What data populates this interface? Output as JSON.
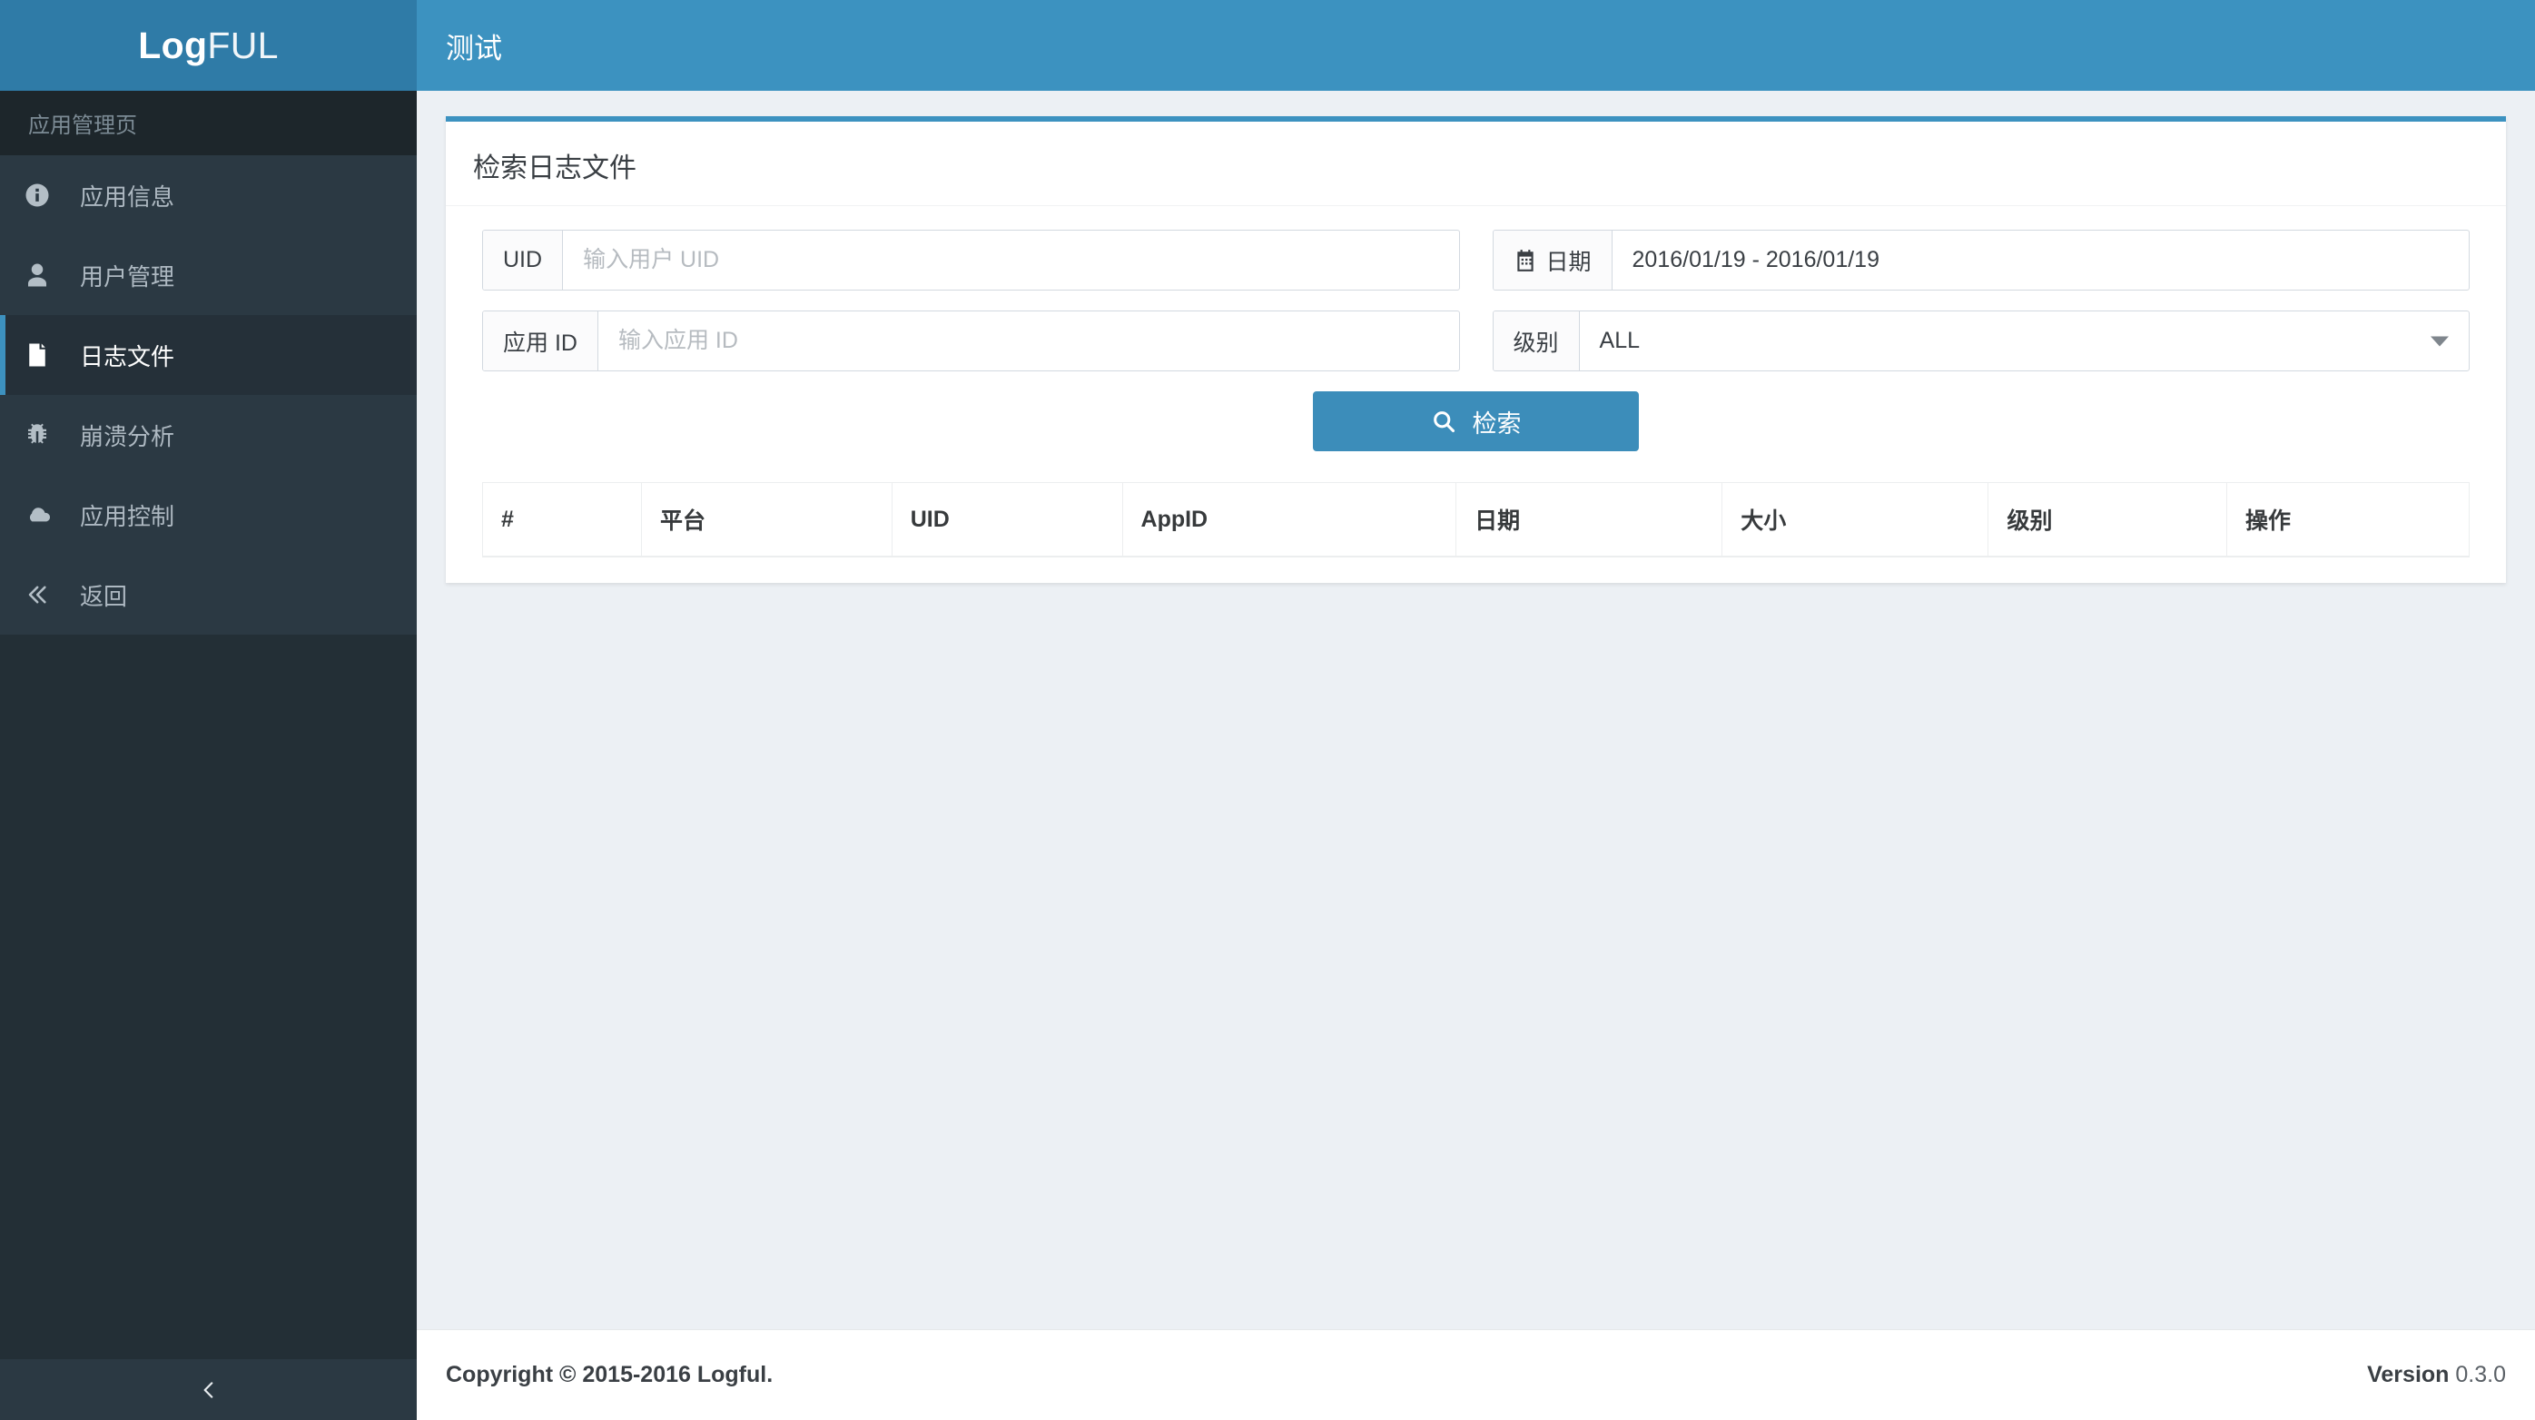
{
  "brand": {
    "bold": "Log",
    "light": "FUL"
  },
  "sidebar": {
    "header": "应用管理页",
    "items": [
      {
        "label": "应用信息",
        "icon": "info-circle-icon",
        "active": false
      },
      {
        "label": "用户管理",
        "icon": "user-icon",
        "active": false
      },
      {
        "label": "日志文件",
        "icon": "file-icon",
        "active": true
      },
      {
        "label": "崩溃分析",
        "icon": "bug-icon",
        "active": false
      },
      {
        "label": "应用控制",
        "icon": "cloud-icon",
        "active": false
      },
      {
        "label": "返回",
        "icon": "double-chevron-left-icon",
        "active": false
      }
    ],
    "collapse_icon": "chevron-left-icon"
  },
  "topbar": {
    "title": "测试"
  },
  "panel": {
    "title": "检索日志文件",
    "form": {
      "uid": {
        "label": "UID",
        "placeholder": "输入用户 UID",
        "value": ""
      },
      "appid": {
        "label": "应用 ID",
        "placeholder": "输入应用 ID",
        "value": ""
      },
      "date": {
        "label": "日期",
        "icon": "calendar-icon",
        "value": "2016/01/19 - 2016/01/19"
      },
      "level": {
        "label": "级别",
        "value": "ALL",
        "options": [
          "ALL"
        ],
        "caret_icon": "chevron-down-icon"
      }
    },
    "search_button": {
      "label": "检索",
      "icon": "search-icon"
    },
    "table": {
      "columns": [
        "#",
        "平台",
        "UID",
        "AppID",
        "日期",
        "大小",
        "级别",
        "操作"
      ],
      "rows": []
    }
  },
  "footer": {
    "copyright": "Copyright © 2015-2016 Logful.",
    "version_label": "Version",
    "version_value": "0.3.0"
  },
  "colors": {
    "brand_blue": "#2f7ba7",
    "topbar_blue": "#3c92c0",
    "accent": "#3c8dba",
    "sidebar_dark": "#232f36",
    "sidebar_item": "#2b3943",
    "sidebar_active": "#253039",
    "page_bg": "#ecf0f4"
  }
}
